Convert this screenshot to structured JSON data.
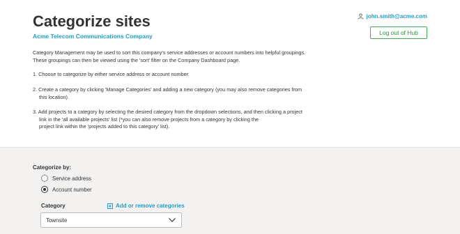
{
  "header": {
    "title": "Categorize sites",
    "company": "Acme Telecom Communications Company",
    "user_email": "john.smith@acme.com",
    "logout_label": "Log out of Hub"
  },
  "intro": {
    "line1": "Category Management may be used to sort this company's service addresses or account numbers into helpful groupings.",
    "line2": "These groupings can then be viewed using the 'sort' filter on the Company Dashboard page."
  },
  "steps": [
    {
      "line1": "1. Choose to categorize by either service address or account number."
    },
    {
      "line1": "2. Create a category by clicking 'Manage Categories' and adding a new category (you may also remove categories from",
      "line2": "this location)."
    },
    {
      "line1": "3. Add projects to a category by selecting the desired category from the dropdown selections, and then clicking a project",
      "line2": "link in the 'all available projects' list (*you can also remove projects from a category by clicking the",
      "line3": "project link within the 'projects added to this category' list)."
    }
  ],
  "form": {
    "categorize_by_label": "Categorize by:",
    "options": [
      {
        "label": "Service address",
        "checked": false
      },
      {
        "label": "Account number",
        "checked": true
      }
    ],
    "category_label": "Category",
    "manage_label": "Add or remove categories",
    "selected_category": "Townsite"
  },
  "colors": {
    "accent_blue": "#1a9fd0",
    "button_green": "#3fb04a",
    "panel_bg": "#f3f2f1"
  }
}
